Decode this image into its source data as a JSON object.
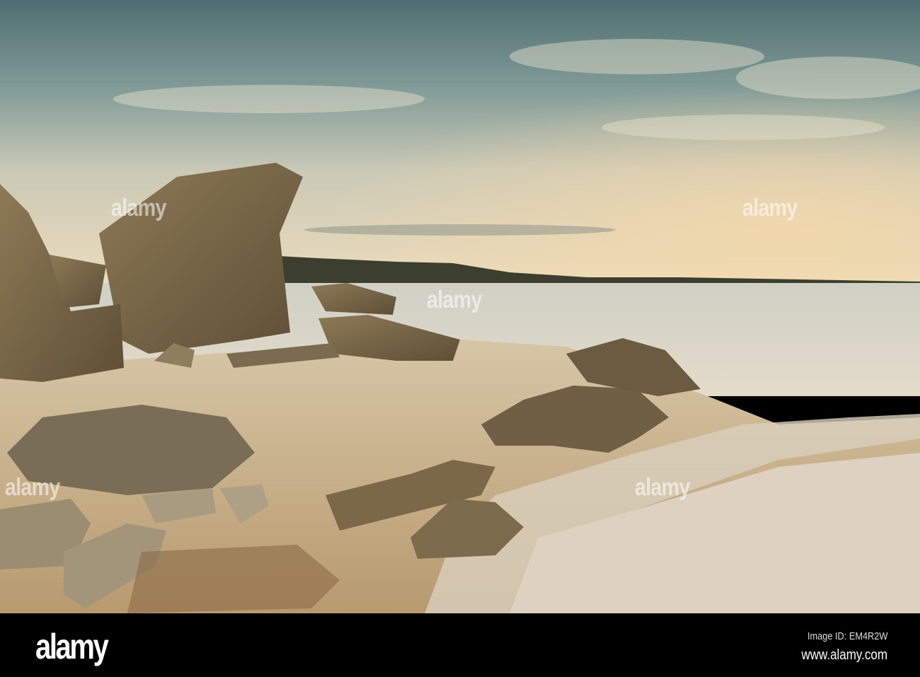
{
  "photo": {
    "subject": "beach-rocks-sunset",
    "watermark_text": "alamy",
    "colors": {
      "sky_top": "#5b7779",
      "sky_horizon": "#ecdfc2",
      "sea": "#d8d5c6",
      "sand": "#c6ae88",
      "rock": "#7a6746"
    }
  },
  "footer": {
    "logo": "alamy",
    "image_id": "Image ID: EM4R2W",
    "website": "www.alamy.com"
  }
}
